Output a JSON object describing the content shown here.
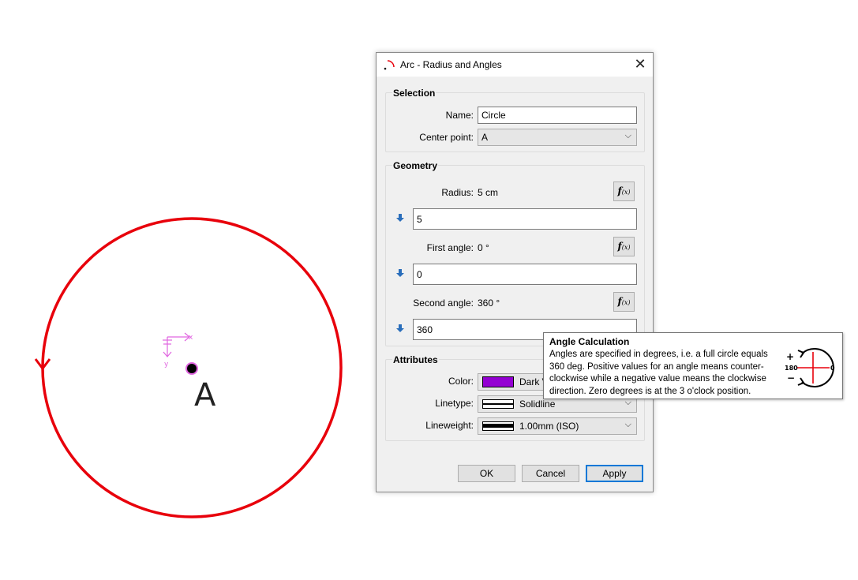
{
  "canvas": {
    "point_label": "A",
    "axis_x_label": "x",
    "axis_y_label": "y",
    "circle_color": "#e8000b",
    "axis_color": "#e066e0"
  },
  "dialog": {
    "title": "Arc - Radius and Angles",
    "close_glyph": "✕",
    "selection": {
      "title": "Selection",
      "name_label": "Name:",
      "name_value": "Circle",
      "center_label": "Center point:",
      "center_value": "A"
    },
    "geometry": {
      "title": "Geometry",
      "radius_label": "Radius:",
      "radius_display": "5 cm",
      "radius_input": "5",
      "first_angle_label": "First angle:",
      "first_angle_display": "0 °",
      "first_angle_input": "0",
      "second_angle_label": "Second angle:",
      "second_angle_display": "360 °",
      "second_angle_input": "360",
      "fx_glyph": "f",
      "fx_sub": "(x)"
    },
    "attributes": {
      "title": "Attributes",
      "color_label": "Color:",
      "color_value": "Dark V",
      "color_hex": "#9400d3",
      "linetype_label": "Linetype:",
      "linetype_value": "Solidline",
      "lineweight_label": "Lineweight:",
      "lineweight_value": "1.00mm (ISO)"
    },
    "buttons": {
      "ok": "OK",
      "cancel": "Cancel",
      "apply": "Apply"
    }
  },
  "tooltip": {
    "title": "Angle Calculation",
    "body": "Angles are specified in degrees, i.e. a full circle equals 360 deg. Positive values for an angle means counter-clockwise while a negative value means the clockwise direction. Zero degrees is at the 3 o'clock position.",
    "diagram": {
      "plus": "+",
      "minus": "−",
      "left": "180",
      "right": "0"
    }
  }
}
